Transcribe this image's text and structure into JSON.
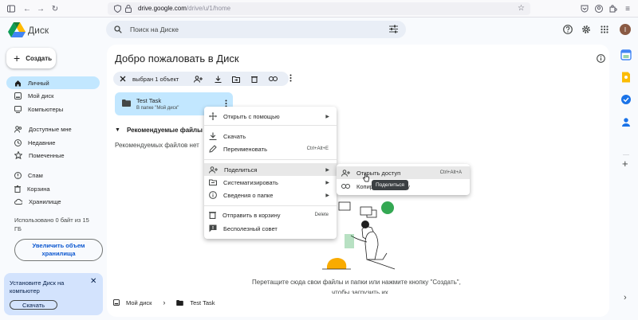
{
  "browser": {
    "url_host": "drive.google.com",
    "url_path": "/drive/u/1/home"
  },
  "app": {
    "name": "Диск",
    "search_placeholder": "Поиск на Диске",
    "avatar_letter": "I"
  },
  "sidebar": {
    "new_label": "Создать",
    "items": [
      {
        "label": "Личный",
        "icon": "home-icon",
        "active": true
      },
      {
        "label": "Мой диск",
        "icon": "my-drive-icon"
      },
      {
        "label": "Компьютеры",
        "icon": "computer-icon"
      },
      {
        "label": "Доступные мне",
        "icon": "people-icon"
      },
      {
        "label": "Недавние",
        "icon": "clock-icon"
      },
      {
        "label": "Помеченные",
        "icon": "star-icon"
      },
      {
        "label": "Спам",
        "icon": "spam-icon"
      },
      {
        "label": "Корзина",
        "icon": "trash-icon"
      },
      {
        "label": "Хранилище",
        "icon": "cloud-icon"
      }
    ],
    "storage_text": "Использовано 0 байт из 15 ГБ",
    "upgrade_label": "Увеличить объем хранилища",
    "promo_text": "Установите Диск на компьютер",
    "promo_button": "Скачать"
  },
  "main": {
    "title": "Добро пожаловать в Диск",
    "selection_label": "выбран 1 объект",
    "folder_name": "Test Task",
    "folder_location": "В папке \"Мой диск\"",
    "recommended_heading": "Рекомендуемые файлы",
    "recommended_text": "Рекомендуемых файлов нет",
    "drop_text": "Перетащите сюда свои файлы и папки или нажмите кнопку \"Создать\",",
    "drop_text2": "чтобы загрузить их"
  },
  "breadcrumb": {
    "root": "Мой диск",
    "current": "Test Task"
  },
  "context_menu": {
    "items": [
      {
        "label": "Открыть с помощью",
        "icon": "open-with-icon",
        "submenu": true
      },
      {
        "label": "Скачать",
        "icon": "download-icon"
      },
      {
        "label": "Переименовать",
        "icon": "rename-icon",
        "shortcut": "Ctrl+Alt+E"
      },
      {
        "label": "Поделиться",
        "icon": "share-icon",
        "submenu": true,
        "highlighted": true
      },
      {
        "label": "Систематизировать",
        "icon": "organize-icon",
        "submenu": true
      },
      {
        "label": "Сведения о папке",
        "icon": "info-icon",
        "submenu": true
      },
      {
        "label": "Отправить в корзину",
        "icon": "trash-icon",
        "shortcut": "Delete"
      },
      {
        "label": "Бесполезный совет",
        "icon": "feedback-icon"
      }
    ]
  },
  "share_submenu": {
    "items": [
      {
        "label": "Открыть доступ",
        "shortcut": "Ctrl+Alt+A",
        "icon": "person-add-icon"
      },
      {
        "label": "Копировать ссылку",
        "icon": "link-icon"
      }
    ]
  },
  "tooltip": "Поделиться",
  "colors": {
    "accent": "#0b57d0",
    "selected": "#c2e7ff",
    "background": "#f8fafd"
  }
}
